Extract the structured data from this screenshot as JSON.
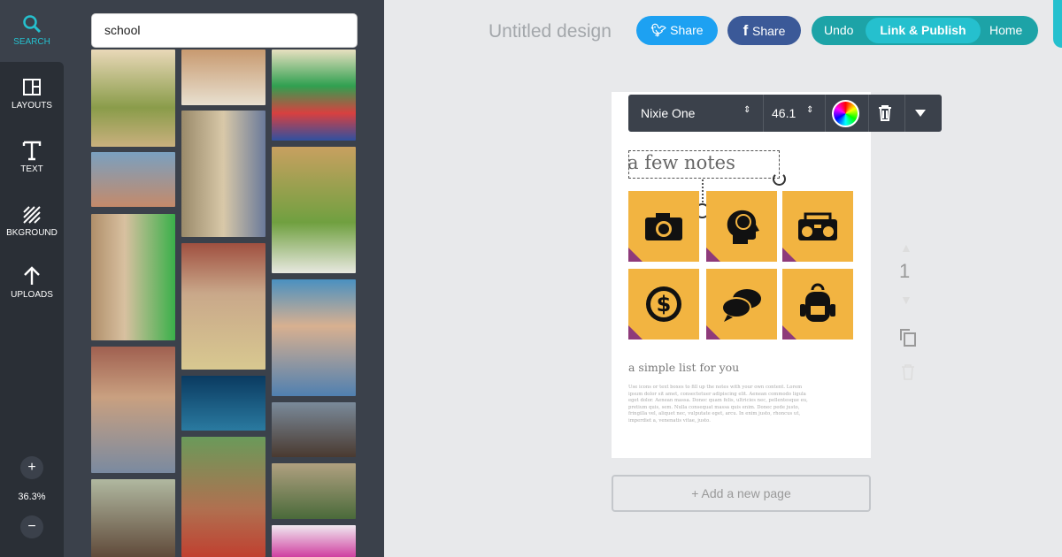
{
  "rail": {
    "items": [
      {
        "label": "SEARCH",
        "icon": "search-icon"
      },
      {
        "label": "LAYOUTS",
        "icon": "layouts-icon"
      },
      {
        "label": "TEXT",
        "icon": "text-icon"
      },
      {
        "label": "BKGROUND",
        "icon": "background-icon"
      },
      {
        "label": "UPLOADS",
        "icon": "upload-icon"
      }
    ],
    "zoom_in": "+",
    "zoom": "36.3%",
    "zoom_out": "−",
    "accent": "#25c0ce"
  },
  "search": {
    "value": "school"
  },
  "header": {
    "title": "Untitled design",
    "twitter_share": "Share",
    "facebook_share": "Share",
    "undo": "Undo",
    "link_publish": "Link & Publish",
    "home": "Home"
  },
  "toolbar": {
    "font": "Nixie One",
    "size": "46.1"
  },
  "design": {
    "heading": "a few notes",
    "tiles": [
      "camera-icon",
      "brain-head-icon",
      "boombox-icon",
      "dollar-icon",
      "chat-icon",
      "backpack-icon"
    ],
    "subheading": "a simple list for you",
    "body": "Use icons or text boxes to fill up the notes with your own content. Lorem ipsum dolor sit amet, consectetuer adipiscing elit. Aenean commodo ligula eget dolor. Aenean massa. Donec quam felis, ultricies nec, pellentesque eu, pretium quis, sem. Nulla consequat massa quis enim. Donec pede justo, fringilla vel, aliquet nec, vulputate eget, arcu. In enim justo, rhoncus ut, imperdiet a, venenatis vitae, justo.",
    "tile_color": "#f2b441",
    "fold_color": "#8e3a7a"
  },
  "page_controls": {
    "page_number": "1"
  },
  "add_page": "+ Add a new page"
}
